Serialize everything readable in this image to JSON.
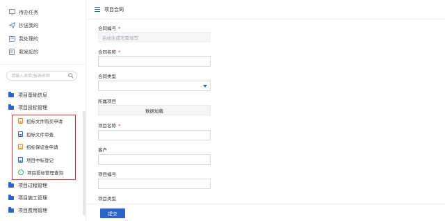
{
  "quick_links": [
    {
      "label": "待办任务",
      "icon": "monitor-icon"
    },
    {
      "label": "抄送我的",
      "icon": "send-icon"
    },
    {
      "label": "我处理的",
      "icon": "inbox-icon"
    },
    {
      "label": "我发起的",
      "icon": "edit-doc-icon"
    }
  ],
  "search": {
    "placeholder": "请输入表单/报表名称"
  },
  "tree": {
    "top": [
      {
        "label": "项目基础信息"
      },
      {
        "label": "项目投标管理"
      }
    ],
    "children": [
      {
        "label": "招标文件购买申请",
        "icon": "doc-icon",
        "color": "#f08a24"
      },
      {
        "label": "招标文件审查",
        "icon": "doc-icon",
        "color": "#2b63c8"
      },
      {
        "label": "招标保证金申请",
        "icon": "doc-icon",
        "color": "#f08a24"
      },
      {
        "label": "项目中标登记",
        "icon": "doc-icon",
        "color": "#2b63c8"
      },
      {
        "label": "项目投标管理查询",
        "icon": "gear-icon",
        "color": "#3aa85b"
      }
    ],
    "bottom": [
      {
        "label": "项目过程管理"
      },
      {
        "label": "项目施工管理"
      },
      {
        "label": "项目费用管理"
      }
    ]
  },
  "header": {
    "title": "项目合同"
  },
  "form": {
    "contract_no": {
      "label": "合同编号",
      "required": "*",
      "placeholder": "自动生成无需填写"
    },
    "contract_name": {
      "label": "合同名称",
      "required": "*"
    },
    "contract_type": {
      "label": "合同类型"
    },
    "project": {
      "label": "所属项目",
      "button": "数据加载"
    },
    "project_name": {
      "label": "项目名称",
      "required": "*"
    },
    "customer": {
      "label": "客户"
    },
    "project_no": {
      "label": "项目编号"
    },
    "project_type": {
      "label": "项目类型"
    }
  },
  "footer": {
    "submit_label": "提交"
  },
  "colors": {
    "accent": "#2b63c8",
    "highlight": "#d9302c"
  }
}
